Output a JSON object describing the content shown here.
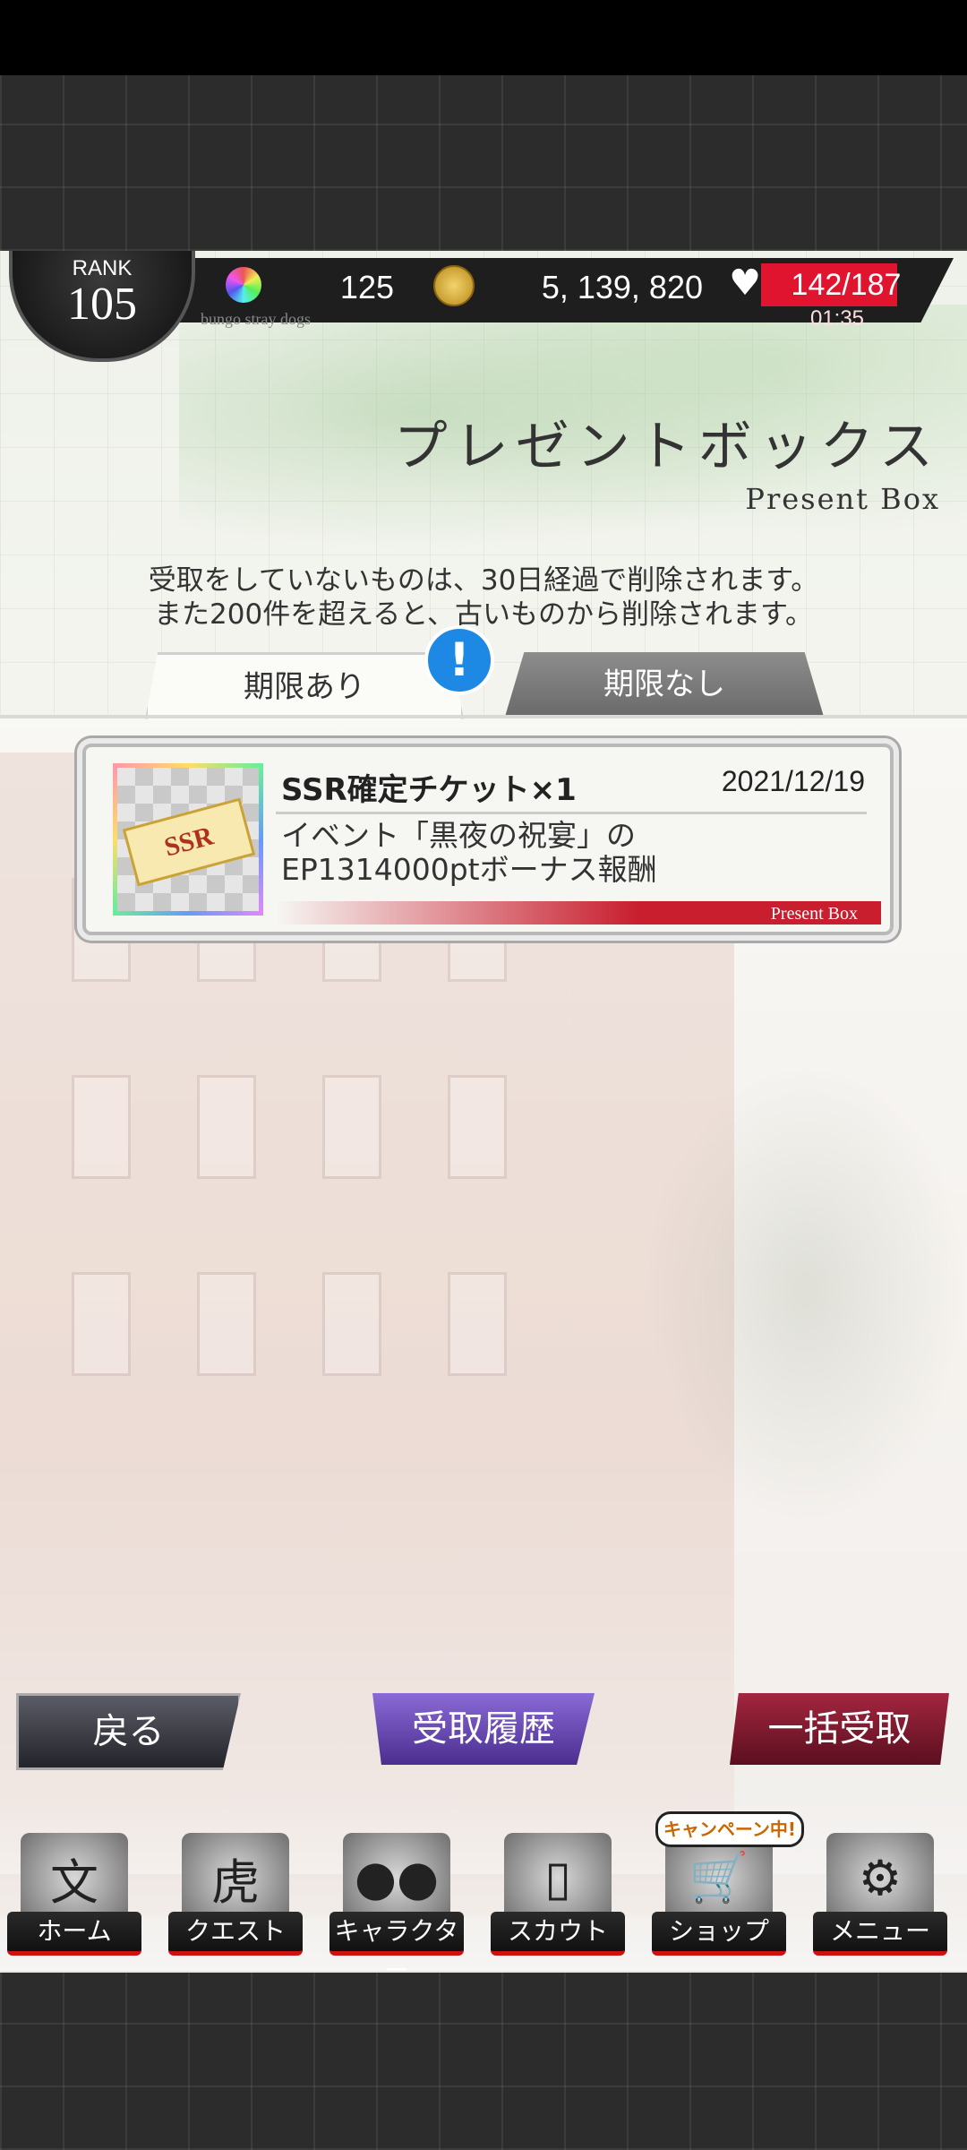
{
  "status": {
    "rank_label": "RANK",
    "rank_value": "105",
    "gems": "125",
    "coins": "5, 139, 820",
    "stamina": "142/187",
    "stamina_fraction": 0.76,
    "stamina_timer": "01:35",
    "tagline": "bungo stray dogs",
    "gem_icon": "gem-icon",
    "coin_icon": "coin-icon",
    "heart_icon": "heart-icon"
  },
  "header": {
    "title": "プレゼントボックス",
    "subtitle": "Present Box",
    "notice_line1": "受取をしていないものは、30日経過で削除されます。",
    "notice_line2": "また200件を超えると、古いものから削除されます。"
  },
  "tabs": [
    {
      "label": "期限あり",
      "active": true
    },
    {
      "label": "期限なし",
      "active": false
    }
  ],
  "alert_badge": "!",
  "items": [
    {
      "name": "SSR確定チケット×1",
      "date": "2021/12/19",
      "desc_line1": "イベント「黒夜の祝宴」の",
      "desc_line2": "EP1314000ptボーナス報酬",
      "footer_label": "Present Box",
      "ticket_text": "SSR"
    }
  ],
  "actions": {
    "back": "戻る",
    "history": "受取履歴",
    "receive_all": "一括受取"
  },
  "nav": {
    "campaign_badge": "キャンペーン中!",
    "items": [
      {
        "label": "ホーム",
        "icon": "home-icon"
      },
      {
        "label": "クエスト",
        "icon": "quest-icon"
      },
      {
        "label": "キャラクター",
        "icon": "character-icon"
      },
      {
        "label": "スカウト",
        "icon": "scout-icon"
      },
      {
        "label": "ショップ",
        "icon": "shop-icon"
      },
      {
        "label": "メニュー",
        "icon": "menu-icon"
      }
    ]
  },
  "colors": {
    "accent_red": "#e0142e",
    "tab_active_bg": "#fbfbf8",
    "alert_blue": "#1e88e5",
    "history_purple": "#6b4bc2"
  }
}
